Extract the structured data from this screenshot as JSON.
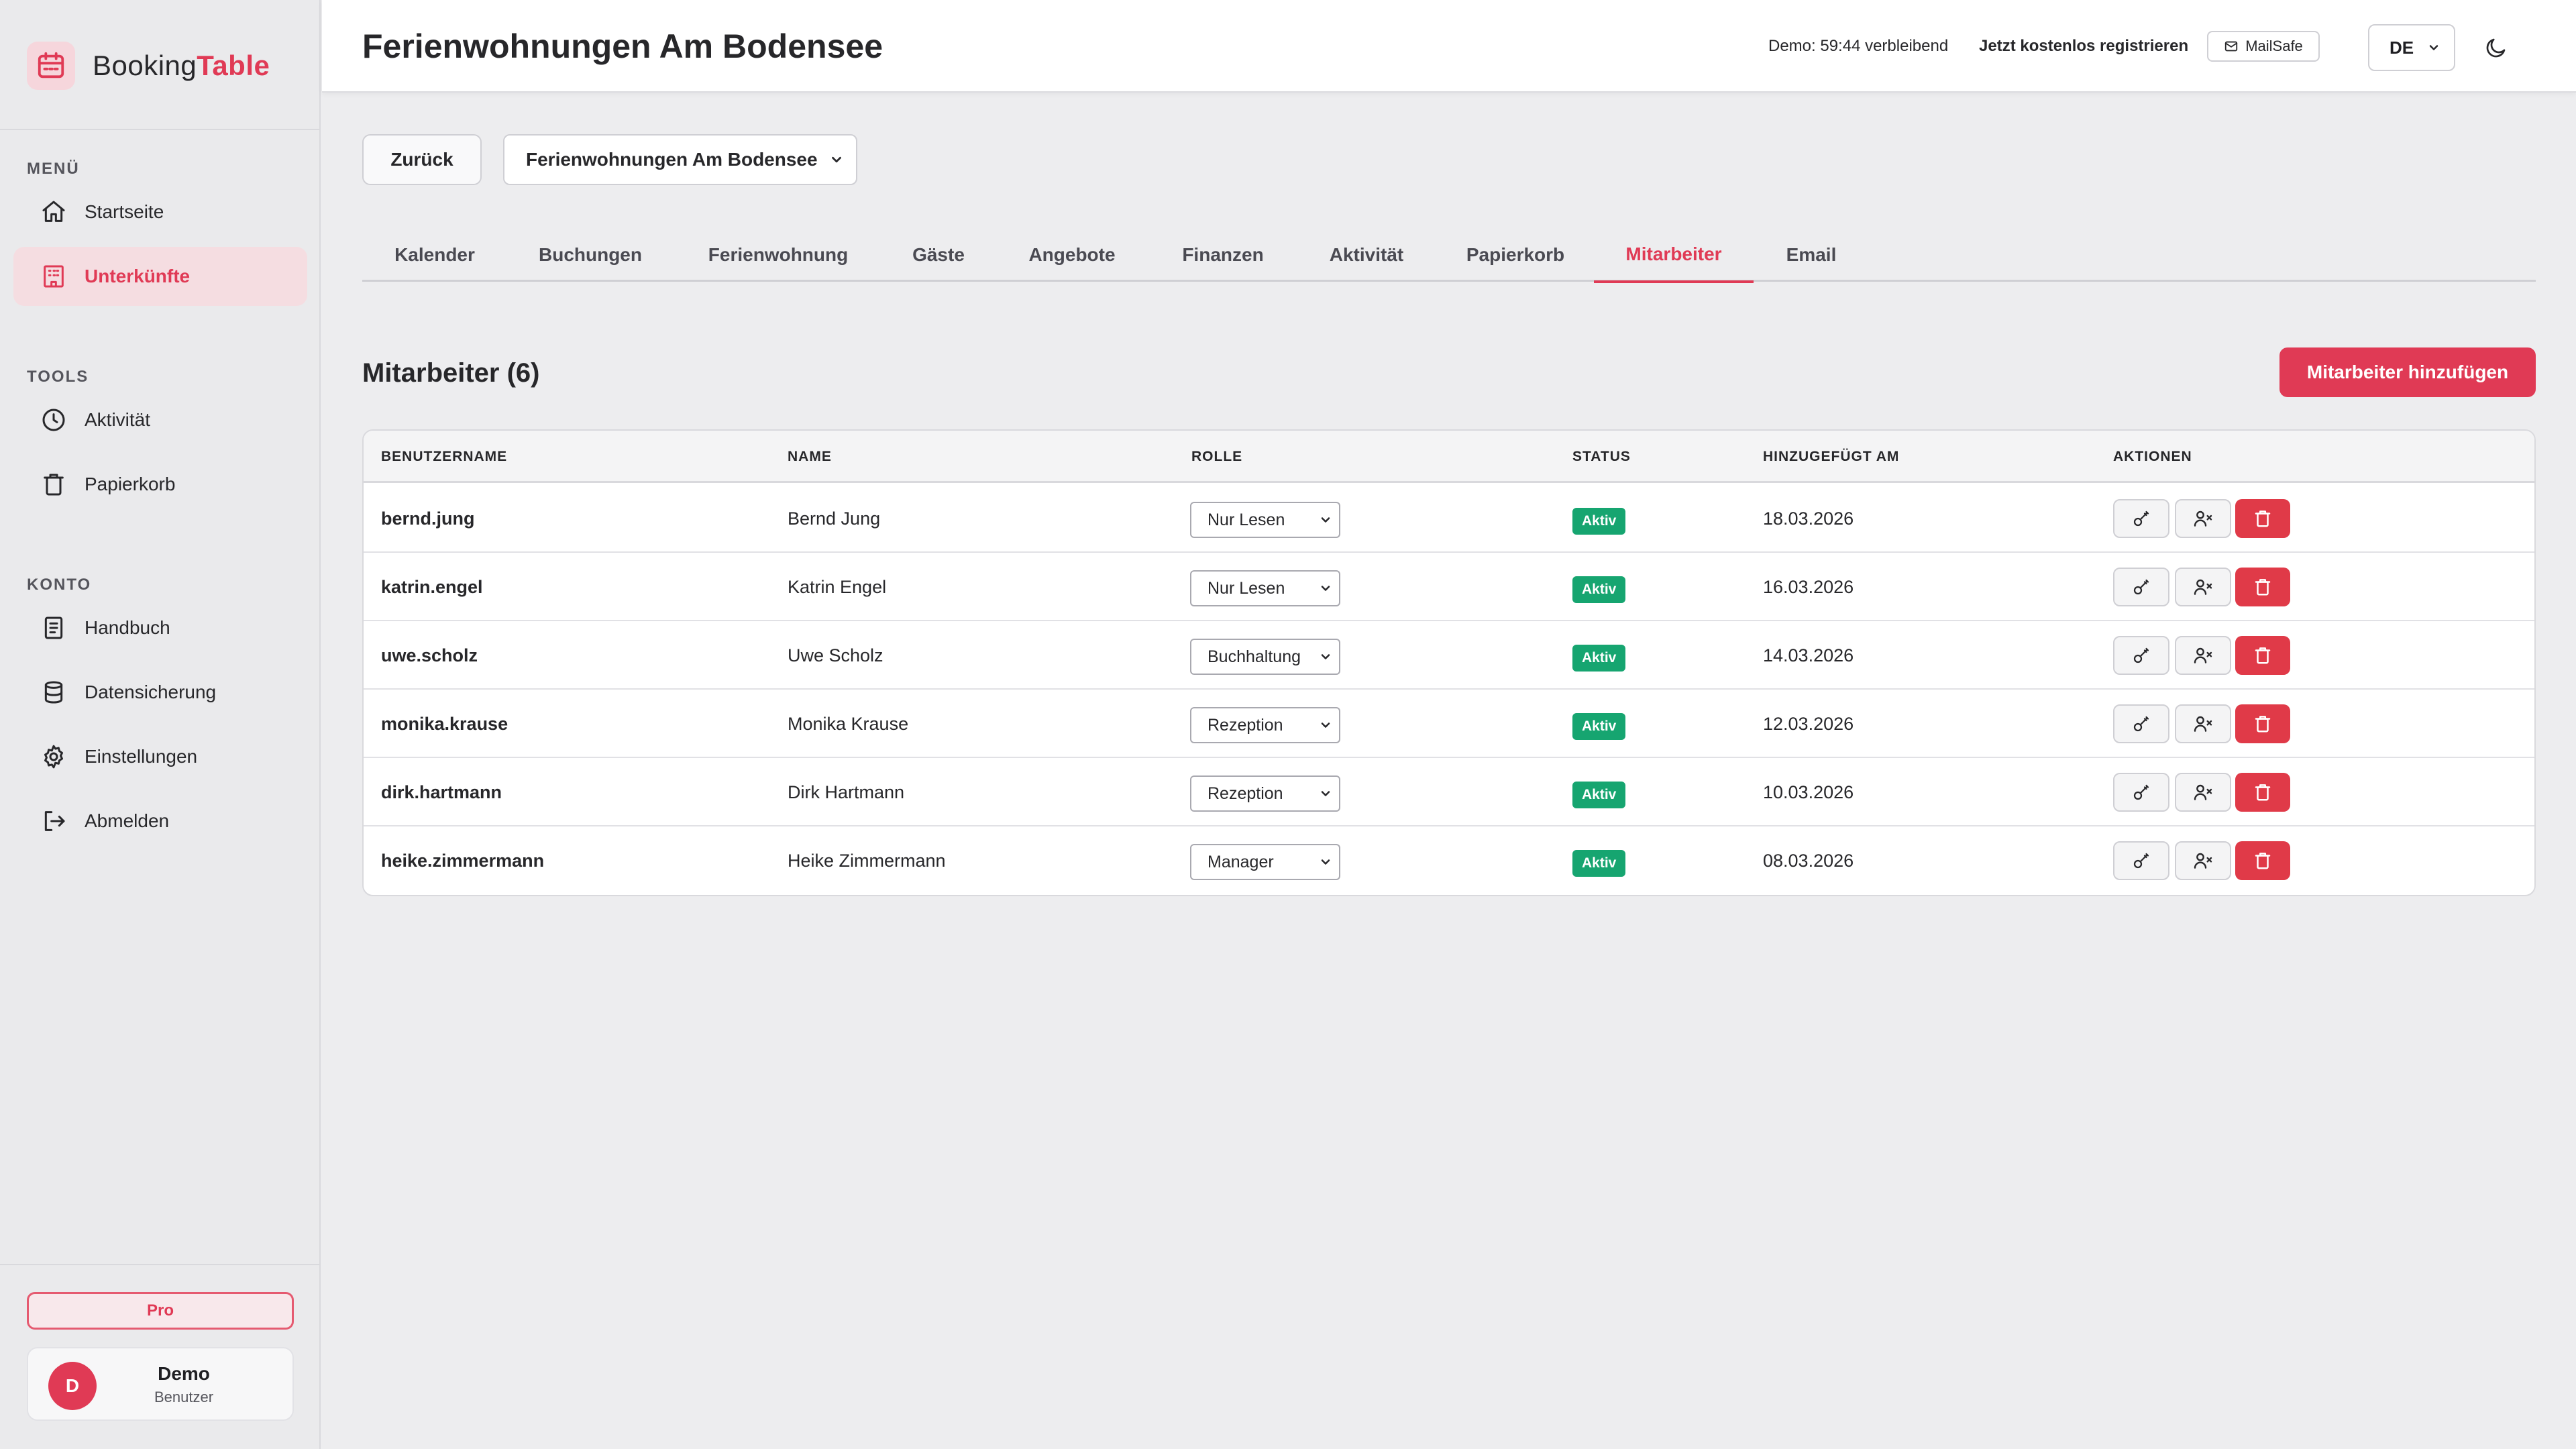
{
  "brand": {
    "name_part1": "Booking",
    "name_part2": "Table"
  },
  "sidebar": {
    "menu_title": "MENÜ",
    "menu_items": [
      {
        "label": "Startseite",
        "icon": "home-icon"
      },
      {
        "label": "Unterkünfte",
        "icon": "building-icon",
        "active": true
      }
    ],
    "tools_title": "TOOLS",
    "tools_items": [
      {
        "label": "Aktivität",
        "icon": "clock-icon"
      },
      {
        "label": "Papierkorb",
        "icon": "trash-icon"
      }
    ],
    "account_title": "KONTO",
    "account_items": [
      {
        "label": "Handbuch",
        "icon": "book-icon"
      },
      {
        "label": "Datensicherung",
        "icon": "database-icon"
      },
      {
        "label": "Einstellungen",
        "icon": "gear-icon"
      },
      {
        "label": "Abmelden",
        "icon": "logout-icon"
      }
    ],
    "plan_badge": "Pro",
    "user": {
      "initial": "D",
      "name": "Demo",
      "role": "Benutzer"
    }
  },
  "header": {
    "title": "Ferienwohnungen Am Bodensee",
    "demo_timer": "Demo: 59:44 verbleibend",
    "register_link": "Jetzt kostenlos registrieren",
    "mailsafe_label": "MailSafe",
    "language": "DE"
  },
  "toolbar": {
    "back_label": "Zurück",
    "property_selected": "Ferienwohnungen Am Bodensee"
  },
  "tabs": [
    {
      "label": "Kalender"
    },
    {
      "label": "Buchungen"
    },
    {
      "label": "Ferienwohnung"
    },
    {
      "label": "Gäste"
    },
    {
      "label": "Angebote"
    },
    {
      "label": "Finanzen"
    },
    {
      "label": "Aktivität"
    },
    {
      "label": "Papierkorb"
    },
    {
      "label": "Mitarbeiter",
      "active": true
    },
    {
      "label": "Email"
    }
  ],
  "staff": {
    "heading": "Mitarbeiter (6)",
    "add_button": "Mitarbeiter hinzufügen",
    "columns": [
      "BENUTZERNAME",
      "NAME",
      "ROLLE",
      "STATUS",
      "HINZUGEFÜGT AM",
      "AKTIONEN"
    ],
    "rows": [
      {
        "username": "bernd.jung",
        "name": "Bernd Jung",
        "role": "Nur Lesen",
        "status": "Aktiv",
        "added": "18.03.2026"
      },
      {
        "username": "katrin.engel",
        "name": "Katrin Engel",
        "role": "Nur Lesen",
        "status": "Aktiv",
        "added": "16.03.2026"
      },
      {
        "username": "uwe.scholz",
        "name": "Uwe Scholz",
        "role": "Buchhaltung",
        "status": "Aktiv",
        "added": "14.03.2026"
      },
      {
        "username": "monika.krause",
        "name": "Monika Krause",
        "role": "Rezeption",
        "status": "Aktiv",
        "added": "12.03.2026"
      },
      {
        "username": "dirk.hartmann",
        "name": "Dirk Hartmann",
        "role": "Rezeption",
        "status": "Aktiv",
        "added": "10.03.2026"
      },
      {
        "username": "heike.zimmermann",
        "name": "Heike Zimmermann",
        "role": "Manager",
        "status": "Aktiv",
        "added": "08.03.2026"
      }
    ]
  },
  "colors": {
    "accent": "#e03a55",
    "status_active": "#16a570",
    "danger": "#e03a48"
  }
}
